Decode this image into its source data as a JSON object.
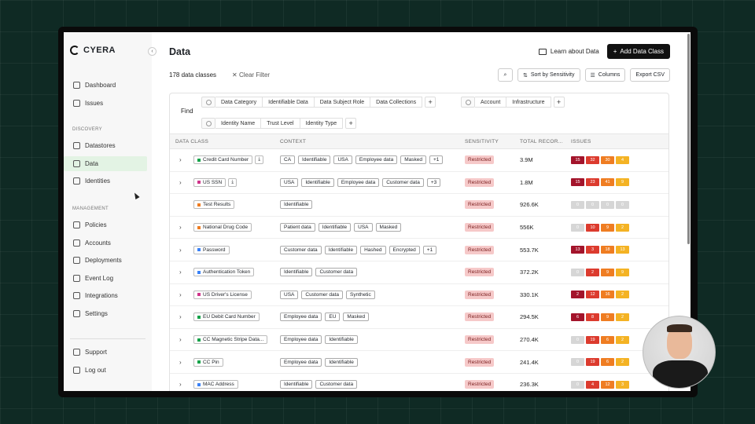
{
  "brand": "CYERA",
  "sidebar": {
    "top_items": [
      {
        "label": "Dashboard",
        "icon": "grid-icon"
      },
      {
        "label": "Issues",
        "icon": "alert-icon"
      }
    ],
    "discovery_title": "DISCOVERY",
    "discovery_items": [
      {
        "label": "Datastores",
        "icon": "database-icon"
      },
      {
        "label": "Data",
        "icon": "data-icon",
        "active": true
      },
      {
        "label": "Identities",
        "icon": "user-icon"
      }
    ],
    "management_title": "MANAGEMENT",
    "management_items": [
      {
        "label": "Policies",
        "icon": "shield-icon"
      },
      {
        "label": "Accounts",
        "icon": "cloud-icon"
      },
      {
        "label": "Deployments",
        "icon": "cube-icon"
      },
      {
        "label": "Event Log",
        "icon": "log-icon"
      },
      {
        "label": "Integrations",
        "icon": "plug-icon"
      },
      {
        "label": "Settings",
        "icon": "gear-icon"
      }
    ],
    "bottom_items": [
      {
        "label": "Support",
        "icon": "help-icon"
      },
      {
        "label": "Log out",
        "icon": "logout-icon"
      }
    ]
  },
  "header": {
    "title": "Data",
    "learn_label": "Learn about Data",
    "add_label": "Add Data Class"
  },
  "filters": {
    "count": "178 data classes",
    "clear_label": "Clear Filter"
  },
  "toolbar": {
    "sort_label": "Sort by Sensitivity",
    "columns_label": "Columns",
    "export_label": "Export CSV"
  },
  "find": {
    "label": "Find",
    "group1": [
      "Data Category",
      "Identifiable Data",
      "Data Subject Role",
      "Data Collections"
    ],
    "group2": [
      "Account",
      "Infrastructure"
    ],
    "group3": [
      "Identity Name",
      "Trust Level",
      "Identity Type"
    ]
  },
  "columns": {
    "data_class": "DATA CLASS",
    "context": "CONTEXT",
    "sensitivity": "SENSITIVITY",
    "total": "TOTAL RECOR...",
    "issues": "ISSUES"
  },
  "colors": {
    "issue_crit": "#a3142b",
    "issue_high": "#dc3b2e",
    "issue_med": "#ef7d22",
    "issue_low": "#f4b324",
    "issue_none": "#d6d6d6"
  },
  "rows": [
    {
      "name": "Credit Card Number",
      "color": "#16a34a",
      "expand": true,
      "dl": true,
      "ctx": [
        "CA",
        "Identifiable",
        "USA",
        "Employee data",
        "Masked",
        "+1"
      ],
      "sens": "Restricted",
      "total": "3.9M",
      "issues": [
        "15",
        "32",
        "30",
        "4"
      ]
    },
    {
      "name": "US SSN",
      "color": "#d0358b",
      "expand": true,
      "dl": true,
      "ctx": [
        "USA",
        "Identifiable",
        "Employee data",
        "Customer data",
        "+3"
      ],
      "sens": "Restricted",
      "total": "1.8M",
      "issues": [
        "15",
        "23",
        "41",
        "9"
      ]
    },
    {
      "name": "Test Results",
      "color": "#ef7d22",
      "expand": false,
      "dl": false,
      "ctx": [
        "Identifiable"
      ],
      "sens": "Restricted",
      "total": "926.6K",
      "issues": [
        "0",
        "0",
        "0",
        "0"
      ]
    },
    {
      "name": "National Drug Code",
      "color": "#ef7d22",
      "expand": true,
      "dl": false,
      "ctx": [
        "Patient data",
        "Identifiable",
        "USA",
        "Masked"
      ],
      "sens": "Restricted",
      "total": "556K",
      "issues": [
        "0",
        "10",
        "9",
        "2"
      ]
    },
    {
      "name": "Password",
      "color": "#3b82f6",
      "expand": true,
      "dl": false,
      "ctx": [
        "Customer data",
        "Identifiable",
        "Hashed",
        "Encrypted",
        "+1"
      ],
      "sens": "Restricted",
      "total": "553.7K",
      "issues": [
        "13",
        "3",
        "18",
        "13"
      ]
    },
    {
      "name": "Authentication Token",
      "color": "#3b82f6",
      "expand": true,
      "dl": false,
      "ctx": [
        "Identifiable",
        "Customer data"
      ],
      "sens": "Restricted",
      "total": "372.2K",
      "issues": [
        "0",
        "2",
        "9",
        "9"
      ]
    },
    {
      "name": "US Driver's License",
      "color": "#d0358b",
      "expand": true,
      "dl": false,
      "ctx": [
        "USA",
        "Customer data",
        "Synthetic"
      ],
      "sens": "Restricted",
      "total": "330.1K",
      "issues": [
        "2",
        "12",
        "16",
        "2"
      ]
    },
    {
      "name": "EU Debit Card Number",
      "color": "#16a34a",
      "expand": true,
      "dl": false,
      "ctx": [
        "Employee data",
        "EU",
        "Masked"
      ],
      "sens": "Restricted",
      "total": "294.5K",
      "issues": [
        "6",
        "8",
        "9",
        "2"
      ]
    },
    {
      "name": "CC Magnetic Stripe Data...",
      "color": "#16a34a",
      "expand": true,
      "dl": false,
      "ctx": [
        "Employee data",
        "Identifiable"
      ],
      "sens": "Restricted",
      "total": "270.4K",
      "issues": [
        "0",
        "19",
        "6",
        "2"
      ]
    },
    {
      "name": "CC Pin",
      "color": "#16a34a",
      "expand": true,
      "dl": false,
      "ctx": [
        "Employee data",
        "Identifiable"
      ],
      "sens": "Restricted",
      "total": "241.4K",
      "issues": [
        "0",
        "19",
        "6",
        "2"
      ]
    },
    {
      "name": "MAC Address",
      "color": "#3b82f6",
      "expand": true,
      "dl": false,
      "ctx": [
        "Identifiable",
        "Customer data"
      ],
      "sens": "Restricted",
      "total": "236.3K",
      "issues": [
        "0",
        "4",
        "12",
        "3"
      ]
    }
  ]
}
